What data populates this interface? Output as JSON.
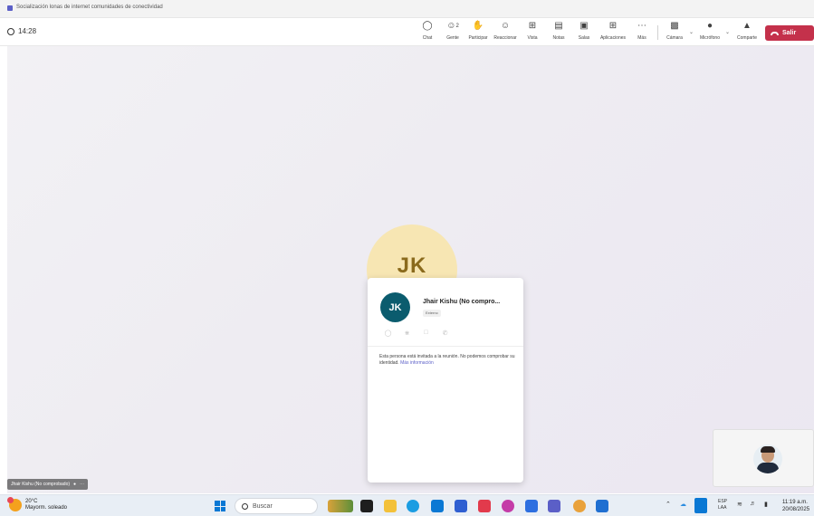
{
  "window": {
    "title": "Socialización lonas de internet comunidades de conectividad"
  },
  "toolbar": {
    "timer": "14:28",
    "buttons": [
      {
        "label": "Chat",
        "icon": "chat-icon"
      },
      {
        "label": "Gente",
        "icon": "people-icon",
        "count": "2"
      },
      {
        "label": "Participar",
        "icon": "raise-hand-icon"
      },
      {
        "label": "Reaccionar",
        "icon": "emoji-icon"
      },
      {
        "label": "Vista",
        "icon": "grid-view-icon"
      },
      {
        "label": "Notas",
        "icon": "notes-icon"
      },
      {
        "label": "Salas",
        "icon": "rooms-icon"
      },
      {
        "label": "Aplicaciones",
        "icon": "apps-add-icon"
      },
      {
        "label": "Más",
        "icon": "more-icon"
      },
      {
        "label": "Cámara",
        "icon": "camera-off-icon"
      },
      {
        "label": "Micrófono",
        "icon": "microphone-icon"
      },
      {
        "label": "Comparte",
        "icon": "share-screen-icon"
      }
    ],
    "leave_label": "Salir"
  },
  "stage": {
    "avatar_initials": "JK",
    "participant_name_tag": "Jhair Kishu (No comprobado)"
  },
  "profile_card": {
    "initials": "JK",
    "name": "Jhair Kishu (No compro...",
    "badge": "Externo",
    "description": "Esta persona está invitada a la reunión. No podemos comprobar su identidad.",
    "link": "Más información"
  },
  "taskbar": {
    "weather_temp": "20°C",
    "weather_desc": "Mayorm. soleado",
    "search_placeholder": "Buscar",
    "lang_line1": "ESP",
    "lang_line2": "LAA",
    "time": "11:19 a.m.",
    "date": "20/08/2025"
  },
  "colors": {
    "accent": "#5b5fc7",
    "leave": "#c4314b",
    "avatar_bg": "#0b5c6e",
    "avatar_big_bg": "#f7e6b3"
  }
}
